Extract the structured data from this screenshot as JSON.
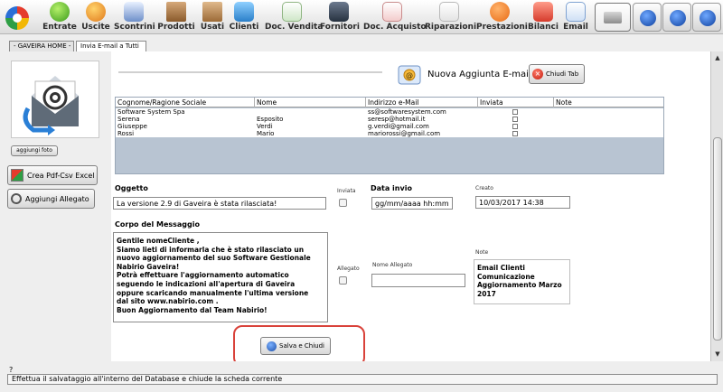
{
  "toolbar": {
    "items": [
      {
        "label": "Entrate",
        "icon": "coin-green-icon"
      },
      {
        "label": "Uscite",
        "icon": "coin-red-icon"
      },
      {
        "label": "Scontrini",
        "icon": "receipt-icon"
      },
      {
        "label": "Prodotti",
        "icon": "boxes-icon"
      },
      {
        "label": "Usati",
        "icon": "box-icon"
      },
      {
        "label": "Clienti",
        "icon": "clients-icon"
      },
      {
        "label": "Doc. Vendita",
        "icon": "document-out-icon"
      },
      {
        "label": "Fornitori",
        "icon": "suppliers-icon"
      },
      {
        "label": "Doc. Acquisto",
        "icon": "document-in-icon"
      },
      {
        "label": "Riparazioni",
        "icon": "repair-icon"
      },
      {
        "label": "Prestazioni",
        "icon": "services-icon"
      },
      {
        "label": "Bilanci",
        "icon": "balance-icon"
      },
      {
        "label": "Email",
        "icon": "email-icon"
      }
    ]
  },
  "tabs": [
    {
      "label": "- GAVEIRA HOME -"
    },
    {
      "label": "Invia E-mail a Tutti"
    }
  ],
  "left": {
    "add_photo_label": "aggiungi foto",
    "export_label": "Crea Pdf-Csv Excel",
    "attach_label": "Aggiungi Allegato"
  },
  "header": {
    "title": "Nuova Aggiunta E-mail",
    "close_label": "Chiudi Tab"
  },
  "table": {
    "columns": [
      "Cognome/Ragione Sociale",
      "Nome",
      "Indirizzo e-Mail",
      "Inviata",
      "Note"
    ],
    "rows": [
      {
        "surname": "Software System Spa",
        "name": "",
        "email": "ss@softwaresystem.com"
      },
      {
        "surname": "Serena",
        "name": "Esposito",
        "email": "seresp@hotmail.it"
      },
      {
        "surname": "Giuseppe",
        "name": "Verdi",
        "email": "g.verdi@gmail.com"
      },
      {
        "surname": "Rossi",
        "name": "Mario",
        "email": "mariorossi@gmail.com"
      }
    ]
  },
  "form": {
    "subject_label": "Oggetto",
    "subject_value": "La versione 2.9 di Gaveira è stata rilasciata!",
    "sent_label": "Inviata",
    "send_date_label": "Data invio",
    "send_date_value": "gg/mm/aaaa hh:mm",
    "created_label": "Creato",
    "created_value": "10/03/2017 14:38",
    "body_label": "Corpo del Messaggio",
    "body_lines": [
      "Gentile nomeCliente ,",
      "Siamo lieti di informarla che è stato rilasciato un",
      "nuovo aggiornamento del suo Software Gestionale",
      "Nabirio Gaveira!",
      "Potrà effettuare l'aggiornamento automatico",
      "seguendo le indicazioni all'apertura di Gaveira",
      "oppure scaricando manualmente l'ultima versione",
      "dal sito www.nabirio.com .",
      "Buon Aggiornamento dal Team Nabirio!"
    ],
    "attached_label": "Allegato",
    "attachment_name_label": "Nome Allegato",
    "attachment_name_value": "",
    "note_label": "Note",
    "note_lines": [
      "Email Clienti",
      "Comunicazione",
      "Aggiornamento Marzo",
      "2017"
    ],
    "save_label": "Salva e Chiudi"
  },
  "status": {
    "marker": "?",
    "message": "Effettua il salvataggio all'interno del Database e chiude la scheda corrente"
  },
  "colors": {
    "highlight": "#d9423a",
    "grid_bg": "#b8c4d2"
  }
}
